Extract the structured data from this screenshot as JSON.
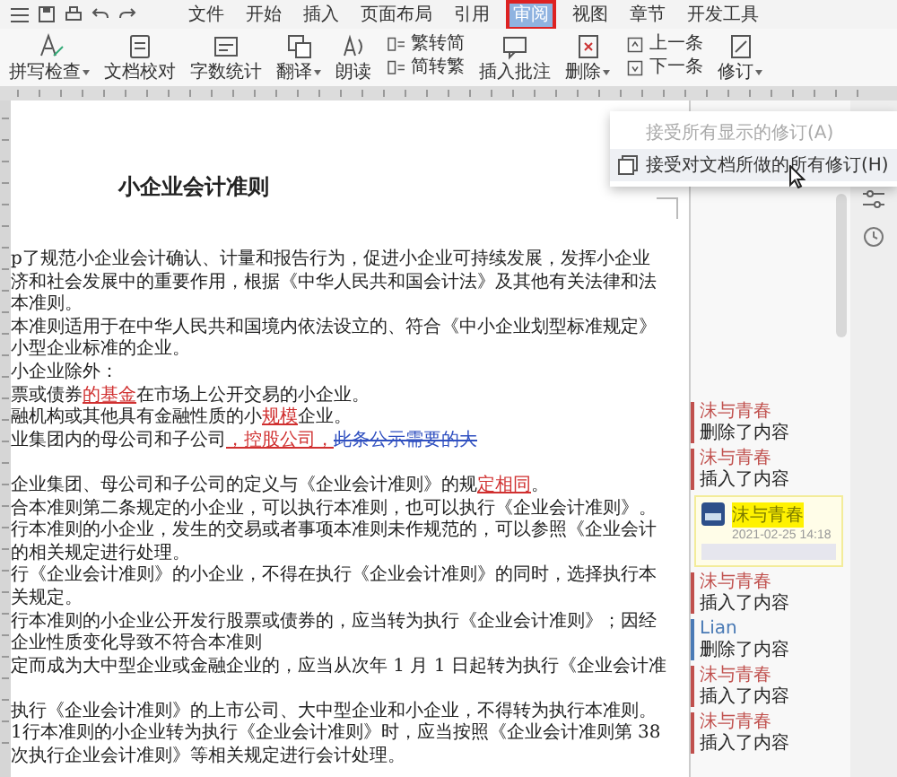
{
  "menu_bar": {
    "tabs": [
      {
        "label": "文件",
        "selected": false
      },
      {
        "label": "开始",
        "selected": false
      },
      {
        "label": "插入",
        "selected": false
      },
      {
        "label": "页面布局",
        "selected": false
      },
      {
        "label": "引用",
        "selected": false
      },
      {
        "label": "审阅",
        "selected": true
      },
      {
        "label": "视图",
        "selected": false
      },
      {
        "label": "章节",
        "selected": false
      },
      {
        "label": "开发工具",
        "selected": false
      }
    ]
  },
  "ribbon": {
    "items": [
      {
        "kind": "large",
        "label": "拼写检查",
        "dropdown": true
      },
      {
        "kind": "large",
        "label": "文档校对",
        "dropdown": false
      },
      {
        "kind": "large",
        "label": "字数统计",
        "dropdown": false
      },
      {
        "kind": "large",
        "label": "翻译",
        "dropdown": true
      },
      {
        "kind": "large",
        "label": "朗读",
        "dropdown": false
      },
      {
        "kind": "stack",
        "items": [
          {
            "label": "繁转简"
          },
          {
            "label": "简转繁"
          }
        ]
      },
      {
        "kind": "large",
        "label": "插入批注",
        "dropdown": false
      },
      {
        "kind": "large",
        "label": "删除",
        "dropdown": true
      },
      {
        "kind": "stack",
        "items": [
          {
            "label": "上一条"
          },
          {
            "label": "下一条"
          }
        ]
      },
      {
        "kind": "large",
        "label": "修订",
        "dropdown": true
      }
    ]
  },
  "document": {
    "lines": [
      {
        "kind": "title",
        "segments": [
          {
            "text": "小企业会计准则",
            "kind": "plain"
          }
        ]
      },
      {
        "kind": "text",
        "segments": [
          {
            "text": "p了规范小企业会计确认、计量和报告行为，促进小企业可持续发展，发挥小企业",
            "kind": "plain"
          }
        ]
      },
      {
        "kind": "text",
        "segments": [
          {
            "text": "济和社会发展中的重要作用，根据《中华人民共和国会计法》及其他有关法律和法",
            "kind": "plain"
          }
        ]
      },
      {
        "kind": "text",
        "segments": [
          {
            "text": "本准则。",
            "kind": "plain"
          }
        ]
      },
      {
        "kind": "text",
        "segments": [
          {
            "text": "本准则适用于在中华人民共和国境内依法设立的、符合《中小企业划型标准规定》",
            "kind": "plain"
          }
        ]
      },
      {
        "kind": "text",
        "segments": [
          {
            "text": "小型企业标准的企业。",
            "kind": "plain"
          }
        ]
      },
      {
        "kind": "text",
        "segments": [
          {
            "text": "小企业除外：",
            "kind": "plain"
          }
        ]
      },
      {
        "kind": "text",
        "segments": [
          {
            "text": "票或债券",
            "kind": "plain"
          },
          {
            "text": "的基金",
            "kind": "inserted"
          },
          {
            "text": "在市场上公开交易的小企业。",
            "kind": "plain"
          }
        ]
      },
      {
        "kind": "text",
        "segments": [
          {
            "text": "融机构或其他具有金融性质的小",
            "kind": "plain"
          },
          {
            "text": "规模",
            "kind": "inserted"
          },
          {
            "text": "企业。",
            "kind": "plain"
          }
        ]
      },
      {
        "kind": "text",
        "segments": [
          {
            "text": "业集团内的母公司和子公司",
            "kind": "plain"
          },
          {
            "text": "，控股公司，",
            "kind": "inserted"
          },
          {
            "text": "此条公示需要的大",
            "kind": "deleted"
          }
        ]
      },
      {
        "kind": "blank"
      },
      {
        "kind": "text",
        "segments": [
          {
            "text": "企业集团、母公司和子公司的定义与《企业会计准则》的规",
            "kind": "plain"
          },
          {
            "text": "定相同",
            "kind": "inserted"
          },
          {
            "text": "。",
            "kind": "plain"
          }
        ]
      },
      {
        "kind": "text",
        "segments": [
          {
            "text": "合本准则第二条规定的小企业，可以执行本准则，也可以执行《企业会计准则》。",
            "kind": "plain"
          }
        ]
      },
      {
        "kind": "text",
        "segments": [
          {
            "text": "行本准则的小企业，发生的交易或者事项本准则未作规范的，可以参照《企业会计",
            "kind": "plain"
          }
        ]
      },
      {
        "kind": "text",
        "segments": [
          {
            "text": "的相关规定进行处理。",
            "kind": "plain"
          }
        ]
      },
      {
        "kind": "text",
        "segments": [
          {
            "text": "行《企业会计准则》的小企业，不得在执行《企业会计准则》的同时，选择执行本",
            "kind": "plain"
          }
        ]
      },
      {
        "kind": "text",
        "segments": [
          {
            "text": "关规定。",
            "kind": "plain"
          }
        ]
      },
      {
        "kind": "text",
        "segments": [
          {
            "text": "行本准则的小企业公开发行股票或债券的，应当转为执行《企业会计准则》；因经",
            "kind": "plain"
          }
        ]
      },
      {
        "kind": "text",
        "segments": [
          {
            "text": "企业性质变化导致不符合本准则",
            "kind": "plain"
          }
        ]
      },
      {
        "kind": "text",
        "segments": [
          {
            "text": "定而成为大中型企业或金融企业的，应当从次年 1 月 1 日起转为执行《企业会计准",
            "kind": "plain"
          }
        ]
      },
      {
        "kind": "blank"
      },
      {
        "kind": "text",
        "segments": [
          {
            "text": "执行《企业会计准则》的上市公司、大中型企业和小企业，不得转为执行本准则。",
            "kind": "plain"
          }
        ]
      },
      {
        "kind": "text",
        "segments": [
          {
            "text": "1行本准则的小企业转为执行《企业会计准则》时，应当按照《企业会计准则第 38",
            "kind": "plain"
          }
        ]
      },
      {
        "kind": "text",
        "segments": [
          {
            "text": "次执行企业会计准则》等相关规定进行会计处理。",
            "kind": "plain"
          }
        ]
      }
    ]
  },
  "markup": {
    "entries": [
      {
        "kind": "revision",
        "author": "沫与青春",
        "action": "删除了内容",
        "color": "#c0504d"
      },
      {
        "kind": "revision",
        "author": "沫与青春",
        "action": "插入了内容",
        "color": "#c0504d"
      },
      {
        "kind": "comment",
        "author": "沫与青春",
        "time": "2021-02-25 14:18"
      },
      {
        "kind": "revision",
        "author": "沫与青春",
        "action": "插入了内容",
        "color": "#c0504d"
      },
      {
        "kind": "revision",
        "author": "Lian",
        "action": "删除了内容",
        "color": "#4a7ab5"
      },
      {
        "kind": "revision",
        "author": "沫与青春",
        "action": "插入了内容",
        "color": "#c0504d"
      },
      {
        "kind": "revision",
        "author": "沫与青春",
        "action": "插入了内容",
        "color": "#c0504d"
      }
    ]
  },
  "popup_menu": {
    "items": [
      {
        "kind": "plain",
        "label": "接受所有显示的修订(A)",
        "disabled": true
      },
      {
        "kind": "with_icon",
        "label": "接受对文档所做的所有修订(H)",
        "disabled": false
      }
    ]
  }
}
